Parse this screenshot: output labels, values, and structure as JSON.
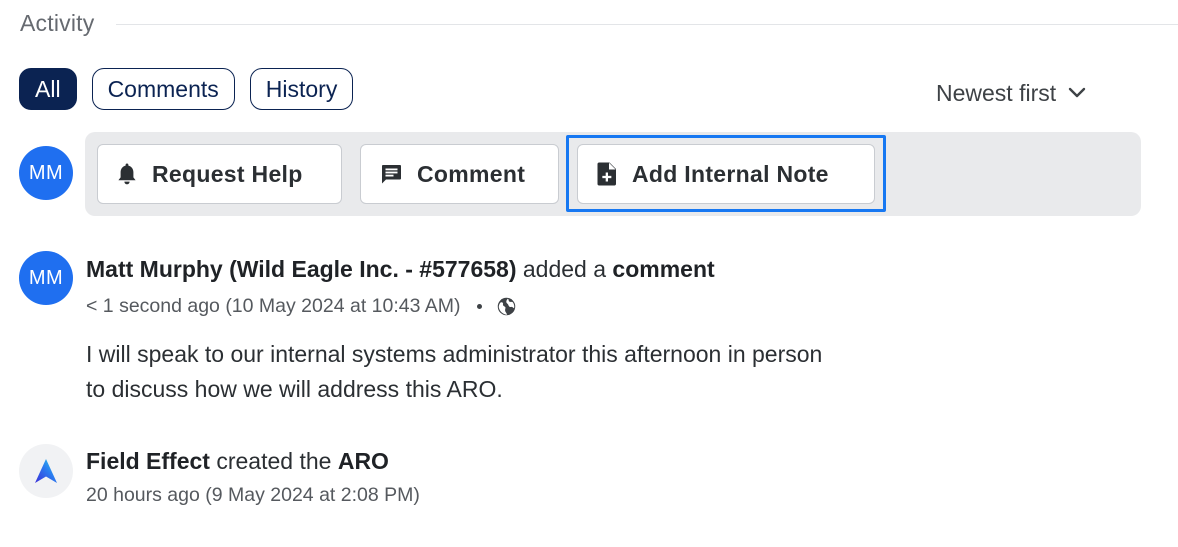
{
  "section": {
    "title": "Activity"
  },
  "filters": [
    {
      "label": "All",
      "active": true
    },
    {
      "label": "Comments",
      "active": false
    },
    {
      "label": "History",
      "active": false
    }
  ],
  "sort": {
    "label": "Newest first",
    "icon": "chevron-down-icon"
  },
  "composer": {
    "avatar_initials": "MM",
    "buttons": {
      "request_help": {
        "label": "Request Help",
        "icon": "bell-icon"
      },
      "comment": {
        "label": "Comment",
        "icon": "comment-icon"
      },
      "add_internal_note": {
        "label": "Add Internal Note",
        "icon": "note-add-icon"
      }
    }
  },
  "entries": [
    {
      "avatar_initials": "MM",
      "author": "Matt Murphy (Wild Eagle Inc. - #577658)",
      "action": " added a ",
      "object": "comment",
      "time": "< 1 second ago (10 May 2024 at 10:43 AM)",
      "visibility_icon": "globe-icon",
      "body_lines": [
        "I will speak to our internal systems administrator this afternoon in person",
        "to discuss how we will address this ARO."
      ]
    },
    {
      "avatar_icon": "field-effect-logo",
      "author": "Field Effect",
      "action": " created the ",
      "object": "ARO",
      "time": "20 hours ago (9 May 2024 at 2:08 PM)"
    }
  ],
  "colors": {
    "navy": "#0b2352",
    "avatar_blue": "#1f6ff0",
    "focus_blue": "#1778f2",
    "bar_bg": "#e9eaec"
  }
}
